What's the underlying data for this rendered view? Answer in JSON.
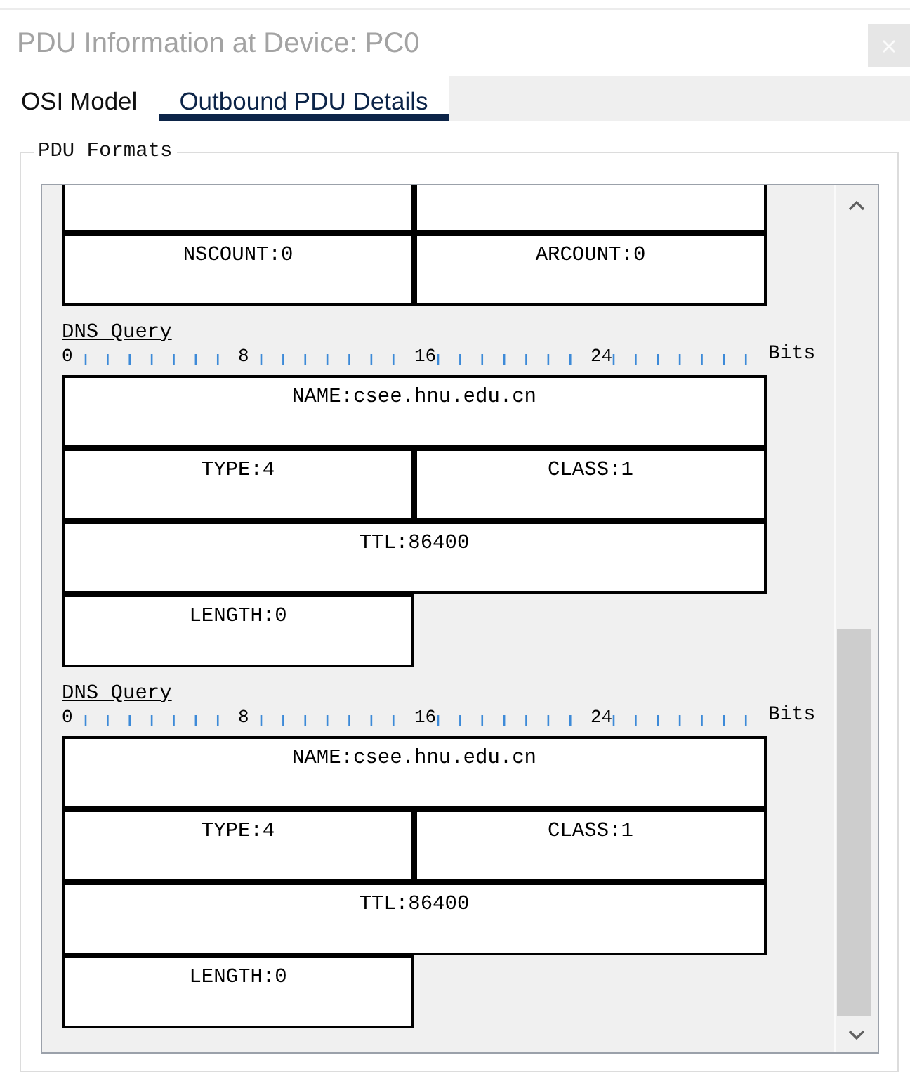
{
  "window": {
    "title": "PDU Information at Device: PC0"
  },
  "tabs": [
    {
      "label": "OSI Model",
      "selected": false
    },
    {
      "label": "Outbound PDU Details",
      "selected": true
    }
  ],
  "pdu_formats": {
    "legend": "PDU Formats",
    "sections": [
      {
        "rows": [
          {
            "kind": "clipped",
            "cells": [
              {
                "kind": "half"
              },
              {
                "kind": "half"
              }
            ]
          },
          {
            "kind": "whole",
            "cells": [
              {
                "label": "NSCOUNT:0",
                "kind": "half"
              },
              {
                "label": "ARCOUNT:0",
                "kind": "half"
              }
            ]
          }
        ]
      },
      {
        "title": "DNS Query",
        "ruler": {
          "marks": [
            "0",
            "8",
            "16",
            "24"
          ],
          "unit": "Bits"
        },
        "rows": [
          {
            "kind": "whole",
            "cells": [
              {
                "label": "NAME:csee.hnu.edu.cn",
                "kind": "full"
              }
            ]
          },
          {
            "kind": "whole",
            "cells": [
              {
                "label": "TYPE:4",
                "kind": "half"
              },
              {
                "label": "CLASS:1",
                "kind": "half"
              }
            ]
          },
          {
            "kind": "whole",
            "cells": [
              {
                "label": "TTL:86400",
                "kind": "full"
              }
            ]
          },
          {
            "kind": "whole",
            "cells": [
              {
                "label": "LENGTH:0",
                "kind": "half"
              }
            ]
          }
        ]
      },
      {
        "title": "DNS Query",
        "ruler": {
          "marks": [
            "0",
            "8",
            "16",
            "24"
          ],
          "unit": "Bits"
        },
        "rows": [
          {
            "kind": "whole",
            "cells": [
              {
                "label": "NAME:csee.hnu.edu.cn",
                "kind": "full"
              }
            ]
          },
          {
            "kind": "whole",
            "cells": [
              {
                "label": "TYPE:4",
                "kind": "half"
              },
              {
                "label": "CLASS:1",
                "kind": "half"
              }
            ]
          },
          {
            "kind": "whole",
            "cells": [
              {
                "label": "TTL:86400",
                "kind": "full"
              }
            ]
          },
          {
            "kind": "whole",
            "cells": [
              {
                "label": "LENGTH:0",
                "kind": "half"
              }
            ]
          }
        ]
      }
    ]
  }
}
